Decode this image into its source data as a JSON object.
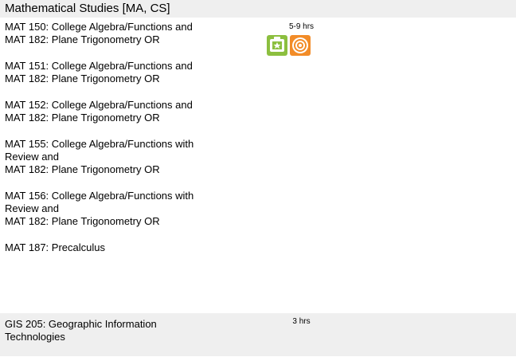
{
  "header": {
    "title": "Mathematical Studies [MA, CS]"
  },
  "math_block": {
    "hours": "5-9 hrs",
    "courses": [
      [
        "MAT 150: College Algebra/Functions and",
        "MAT 182: Plane Trigonometry OR"
      ],
      [
        "MAT 151: College Algebra/Functions and",
        "MAT 182: Plane Trigonometry OR"
      ],
      [
        "MAT 152: College Algebra/Functions and",
        "MAT 182: Plane Trigonometry OR"
      ],
      [
        "MAT 155: College Algebra/Functions with",
        "Review and",
        "MAT 182: Plane Trigonometry OR"
      ],
      [
        "MAT 156: College Algebra/Functions with",
        "Review and",
        "MAT 182: Plane Trigonometry OR"
      ],
      [
        "MAT 187: Precalculus"
      ]
    ],
    "badges": [
      {
        "icon": "green-book-badge-icon",
        "color": "#8cbf3f"
      },
      {
        "icon": "orange-target-badge-icon",
        "color": "#f28c28"
      }
    ]
  },
  "gis_block": {
    "hours": "3 hrs",
    "courses": [
      [
        "GIS 205: Geographic Information",
        "Technologies"
      ]
    ]
  }
}
